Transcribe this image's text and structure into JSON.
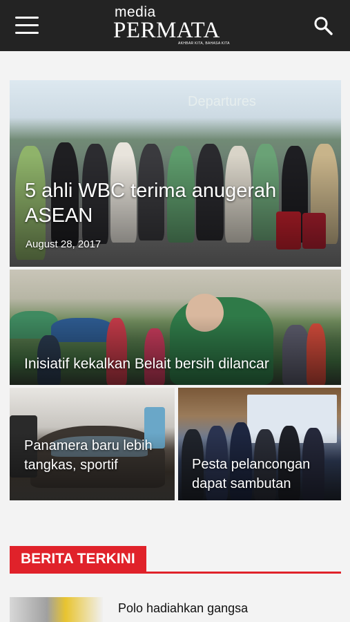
{
  "header": {
    "logo_top": "media",
    "logo_main": "PERMATA",
    "logo_tagline": "AKHBAR KITA, BAHASA KITA"
  },
  "featured": [
    {
      "title": "5 ahli WBC terima anugerah ASEAN",
      "date": "August 28, 2017",
      "image_sign": "Departures"
    },
    {
      "title": "Inisiatif kekalkan Belait bersih dilancar"
    },
    {
      "title": "Panamera baru lebih tangkas, sportif"
    },
    {
      "title": "Pesta pelancongan dapat sambutan"
    }
  ],
  "latest": {
    "section_title": "BERITA TERKINI",
    "items": [
      {
        "title": "Polo hadiahkan gangsa"
      }
    ]
  },
  "colors": {
    "header_bg": "#232323",
    "accent": "#e0222a",
    "page_bg": "#f3f3f3"
  }
}
